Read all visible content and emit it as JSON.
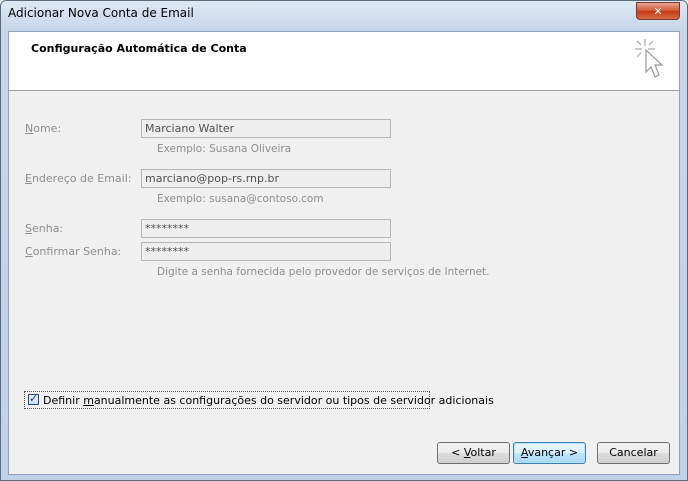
{
  "window": {
    "title": "Adicionar Nova Conta de Email",
    "close_glyph": "✕"
  },
  "header": {
    "title": "Configuração Automática de Conta",
    "icon": "magic-wand-cursor-icon"
  },
  "form": {
    "name": {
      "label_pre": "",
      "label_ul": "N",
      "label_post": "ome:",
      "value": "Marciano Walter",
      "hint": "Exemplo: Susana Oliveira"
    },
    "email": {
      "label_pre": "",
      "label_ul": "E",
      "label_post": "ndereço de Email:",
      "value": "marciano@pop-rs.rnp.br",
      "hint": "Exemplo: susana@contoso.com"
    },
    "password": {
      "label_pre": "",
      "label_ul": "S",
      "label_post": "enha:",
      "value": "********"
    },
    "confirm": {
      "label_pre": "",
      "label_ul": "C",
      "label_post": "onfirmar Senha:",
      "value": "********",
      "hint": "Digite a senha fornecida pelo provedor de serviços de Internet."
    }
  },
  "manual": {
    "checked": true,
    "label_pre": "Definir ",
    "label_ul": "m",
    "label_post": "anualmente as configurações do servidor ou tipos de servidor adicionais"
  },
  "buttons": {
    "back": {
      "pre": "< ",
      "ul": "V",
      "post": "oltar"
    },
    "next": {
      "pre": "",
      "ul": "A",
      "post": "vançar >"
    },
    "cancel": {
      "label": "Cancelar"
    }
  },
  "colors": {
    "titlebar": "#c7d7eb",
    "close": "#c43b16",
    "client": "#f0f0f0",
    "disabled_text": "#8d8d8d"
  }
}
